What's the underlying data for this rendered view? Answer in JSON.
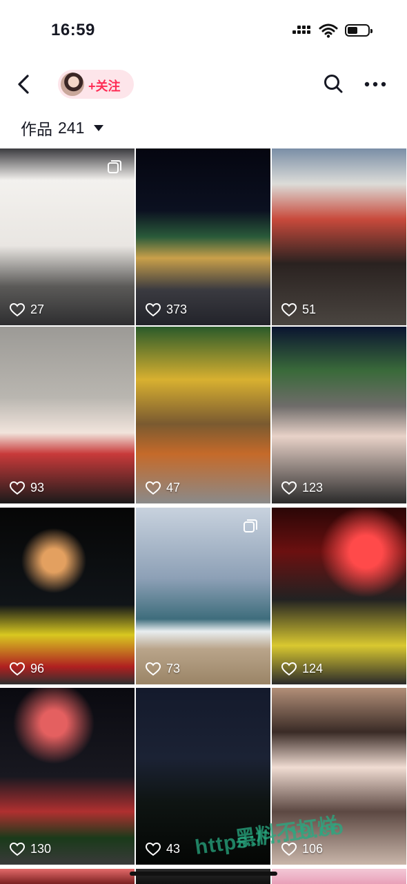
{
  "status_bar": {
    "time": "16:59"
  },
  "nav": {
    "follow_label": "+关注"
  },
  "works": {
    "label": "作品",
    "count": "241"
  },
  "grid": [
    {
      "likes": "27",
      "multi": true
    },
    {
      "likes": "373",
      "multi": false
    },
    {
      "likes": "51",
      "multi": false
    },
    {
      "likes": "93",
      "multi": false
    },
    {
      "likes": "47",
      "multi": false
    },
    {
      "likes": "123",
      "multi": false
    },
    {
      "likes": "96",
      "multi": false
    },
    {
      "likes": "73",
      "multi": true
    },
    {
      "likes": "124",
      "multi": false
    },
    {
      "likes": "130",
      "multi": false
    },
    {
      "likes": "43",
      "multi": false
    },
    {
      "likes": "106",
      "multi": false
    }
  ],
  "watermark": {
    "line1": "黑料不打烊",
    "line2": "https://...19.co"
  },
  "colors": {
    "accent": "#fe2c55",
    "pill_bg": "#fde5ea",
    "text": "#161823"
  }
}
